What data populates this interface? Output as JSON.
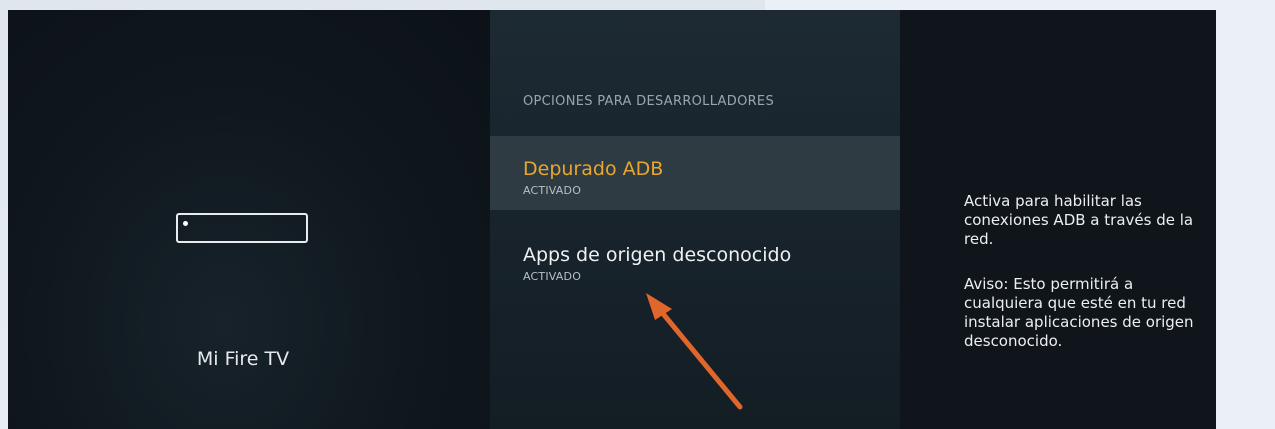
{
  "device": {
    "name": "Mi Fire TV"
  },
  "menu": {
    "section_title": "OPCIONES PARA DESARROLLADORES",
    "items": [
      {
        "label": "Depurado ADB",
        "status": "ACTIVADO",
        "selected": true
      },
      {
        "label": "Apps de origen desconocido",
        "status": "ACTIVADO",
        "selected": false
      }
    ]
  },
  "description": {
    "text1": "Activa para habilitar las conexiones ADB a través de la red.",
    "text2": "Aviso: Esto permitirá a cualquiera que esté en tu red instalar aplicaciones de origen desconocido."
  },
  "colors": {
    "accent": "#e9a62d",
    "annotation_arrow": "#e0662b"
  },
  "icons": {
    "device": "fire-tv-device-icon",
    "arrow": "annotation-arrow-icon"
  }
}
